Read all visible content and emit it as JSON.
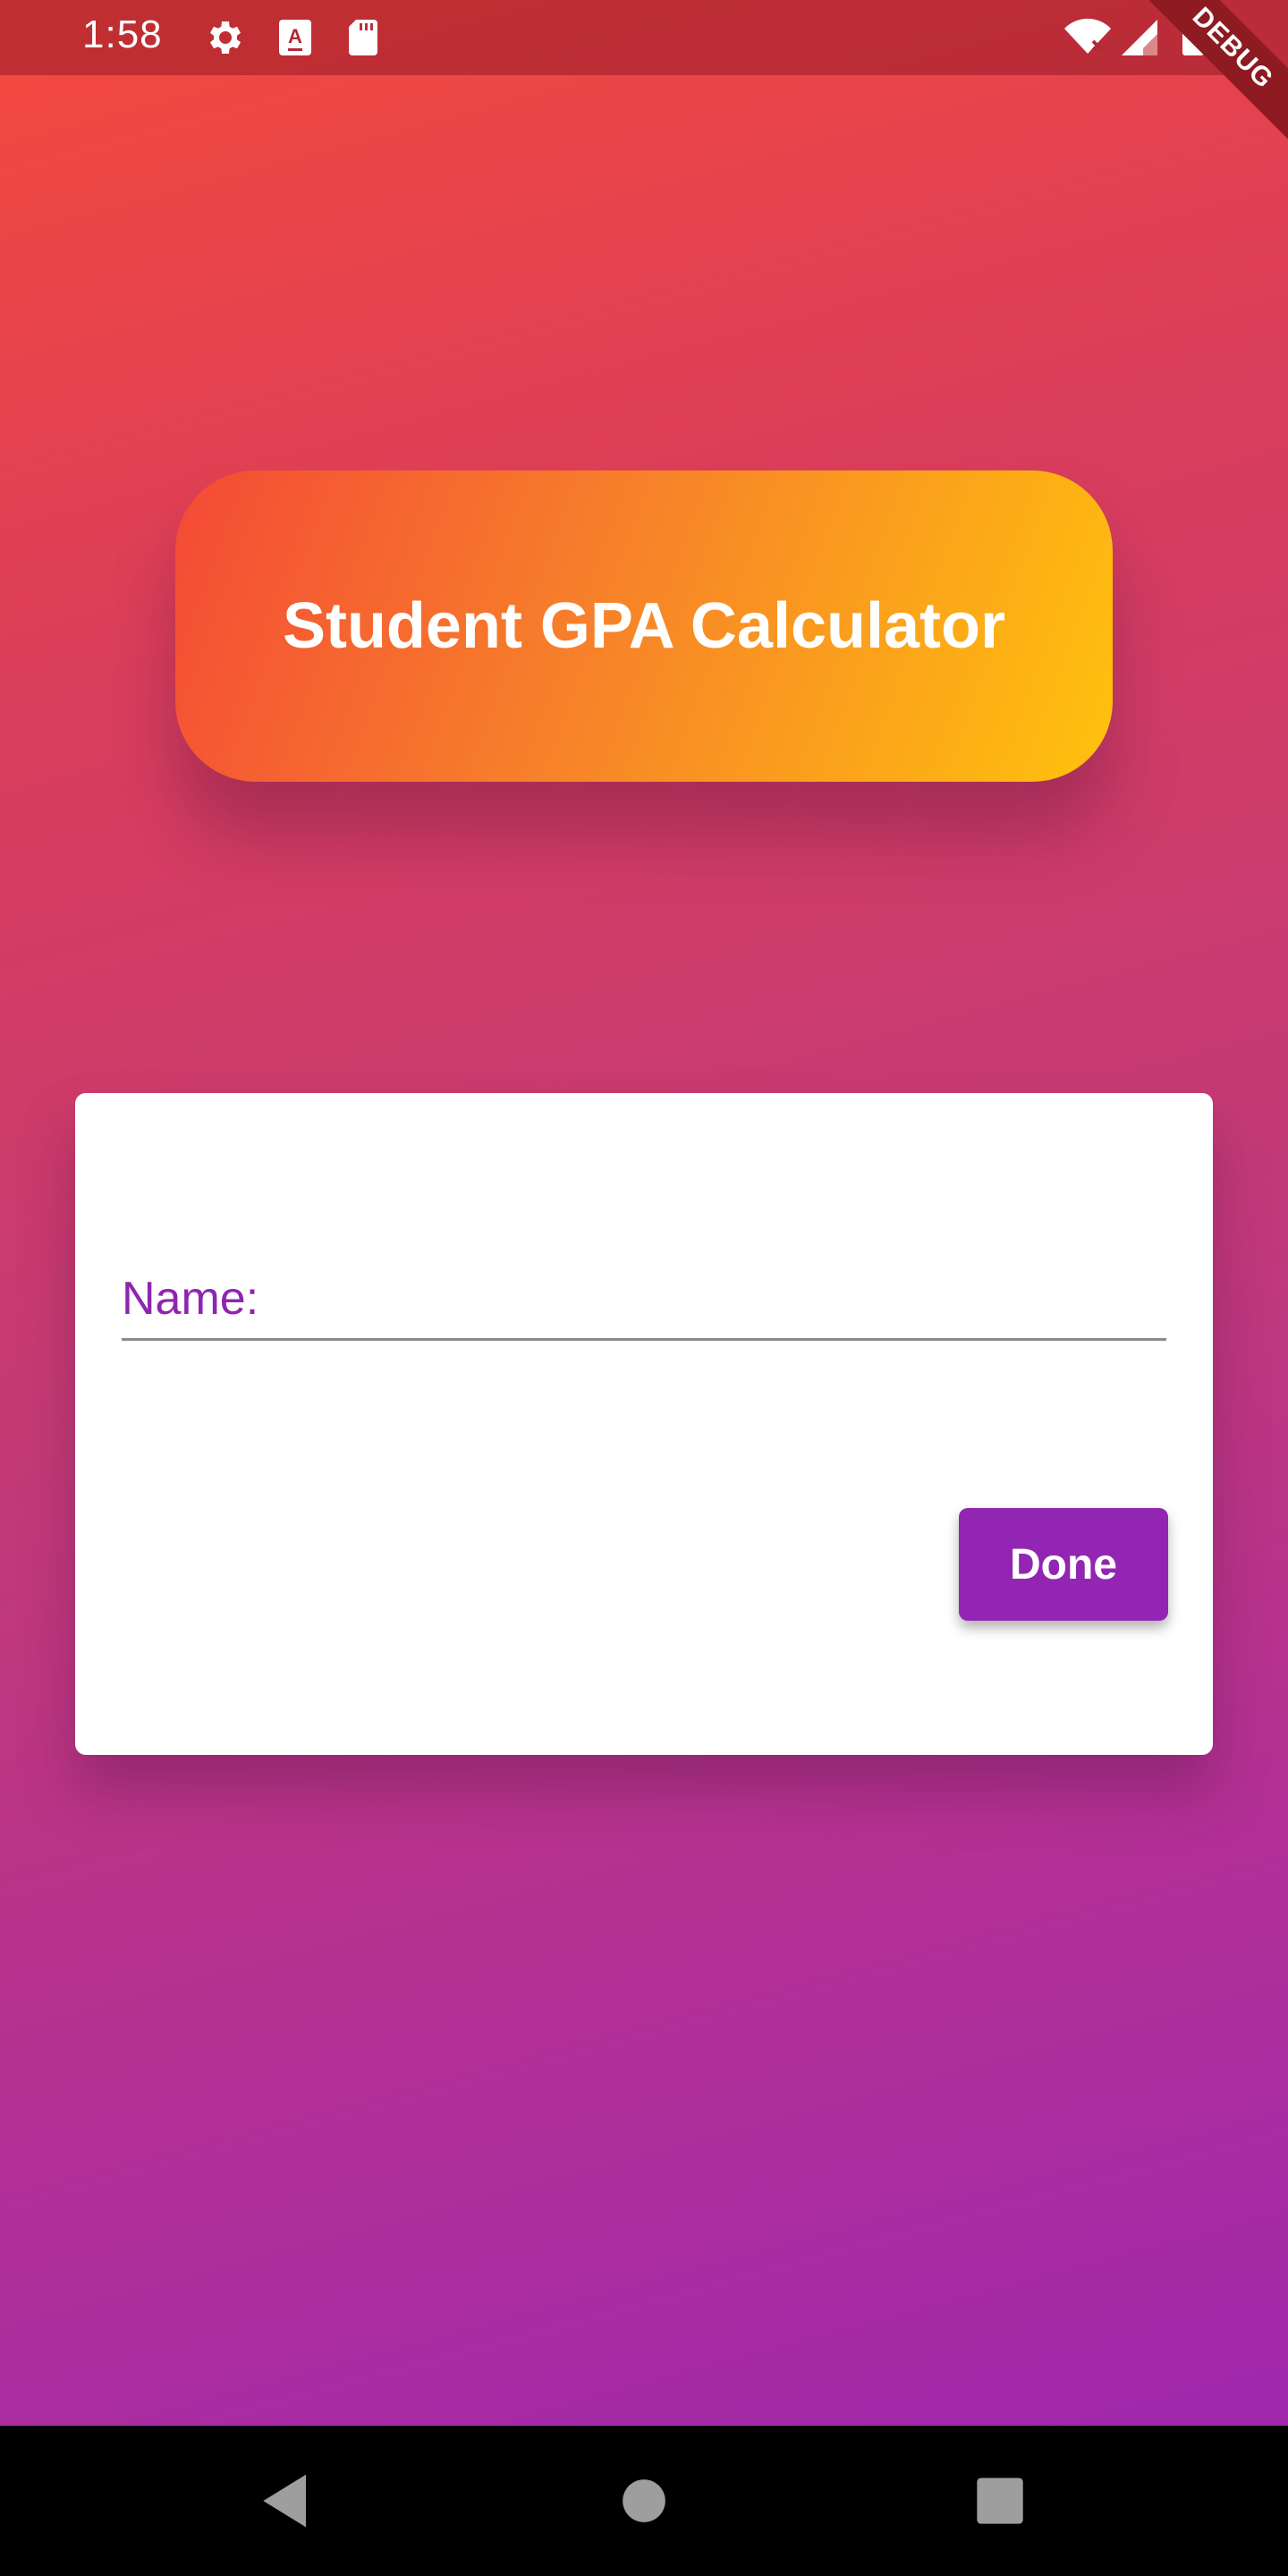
{
  "status_bar": {
    "time": "1:58",
    "icons": [
      "settings-icon",
      "a-keyboard-icon",
      "sd-card-icon",
      "wifi-icon",
      "signal-icon",
      "battery-icon"
    ]
  },
  "debug_banner": "DEBUG",
  "title_card": {
    "title": "Student GPA Calculator"
  },
  "form": {
    "name_label": "Name:",
    "name_value": "",
    "done_label": "Done"
  },
  "nav_bar": {
    "icons": [
      "back-icon",
      "home-icon",
      "recents-icon"
    ]
  },
  "colors": {
    "accent": "#9226b3",
    "title_gradient_start": "#f44a36",
    "title_gradient_end": "#ffc20d"
  }
}
